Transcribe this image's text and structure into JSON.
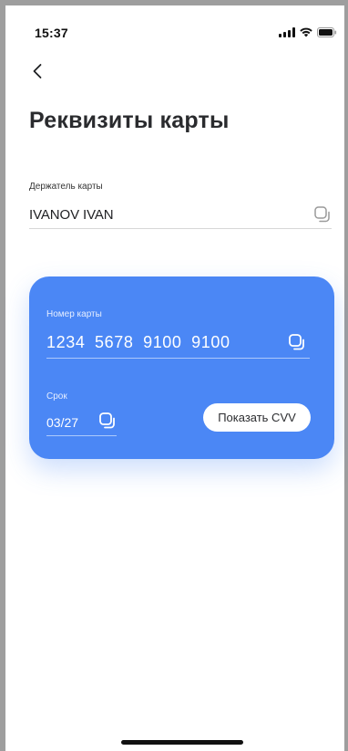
{
  "status_bar": {
    "time": "15:37",
    "signal_icon": "signal-bars-icon",
    "wifi_icon": "wifi-icon",
    "battery_icon": "battery-icon"
  },
  "nav": {
    "back_icon": "chevron-left-icon"
  },
  "page": {
    "title": "Реквизиты карты"
  },
  "holder": {
    "label": "Держатель карты",
    "value": "IVANOV IVAN",
    "copy_icon": "copy-icon"
  },
  "card": {
    "number_label": "Номер карты",
    "number": "1234 5678 9100 9100",
    "expiry_label": "Срок",
    "expiry": "03/27",
    "show_cvv_label": "Показать CVV",
    "background_color": "#4b87f5"
  },
  "colors": {
    "accent": "#4b87f5",
    "text_primary": "#1f2023",
    "divider": "#d7d7d7"
  }
}
